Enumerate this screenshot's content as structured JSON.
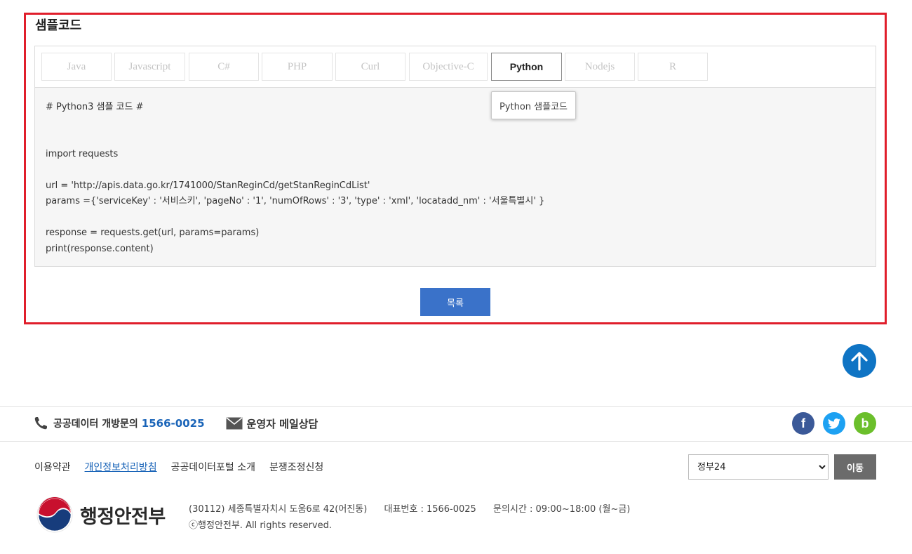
{
  "section": {
    "title": "샘플코드"
  },
  "tabs": [
    {
      "label": "Java"
    },
    {
      "label": "Javascript"
    },
    {
      "label": "C#"
    },
    {
      "label": "PHP"
    },
    {
      "label": "Curl"
    },
    {
      "label": "Objective-C"
    },
    {
      "label": "Python",
      "active": true
    },
    {
      "label": "Nodejs"
    },
    {
      "label": "R"
    }
  ],
  "tooltip": "Python 샘플코드",
  "code_lines": [
    "# Python3 샘플 코드 #",
    "",
    "",
    "import requests",
    "",
    "url = 'http://apis.data.go.kr/1741000/StanReginCd/getStanReginCdList'",
    "params ={'serviceKey' : '서비스키', 'pageNo' : '1', 'numOfRows' : '3', 'type' : 'xml', 'locatadd_nm' : '서울특별시' }",
    "",
    "response = requests.get(url, params=params)",
    "print(response.content)"
  ],
  "list_button": "목록",
  "footer": {
    "contact_label": "공공데이터 개방문의",
    "contact_phone": "1566-0025",
    "mail_label": "운영자 메일상담",
    "sns": [
      {
        "name": "facebook",
        "glyph": "f",
        "color": "#3b5998"
      },
      {
        "name": "twitter",
        "glyph": "t",
        "color": "#1da1f2"
      },
      {
        "name": "blog",
        "glyph": "b",
        "color": "#6bbf2b"
      }
    ],
    "links": [
      "이용약관",
      "개인정보처리방침",
      "공공데이터포털 소개",
      "분쟁조정신청"
    ],
    "site_select": "정부24",
    "go_button": "이동",
    "logo_text": "행정안전부",
    "address": "(30112) 세종특별자치시 도움6로 42(어진동)",
    "main_phone": "대표번호 : 1566-0025",
    "hours": "문의시간 : 09:00~18:00 (월~금)",
    "copyright": "ⓒ행정안전부. All rights reserved."
  },
  "icons": {
    "phone": "phone-icon",
    "mail": "mail-icon",
    "top": "arrow-up-icon"
  }
}
